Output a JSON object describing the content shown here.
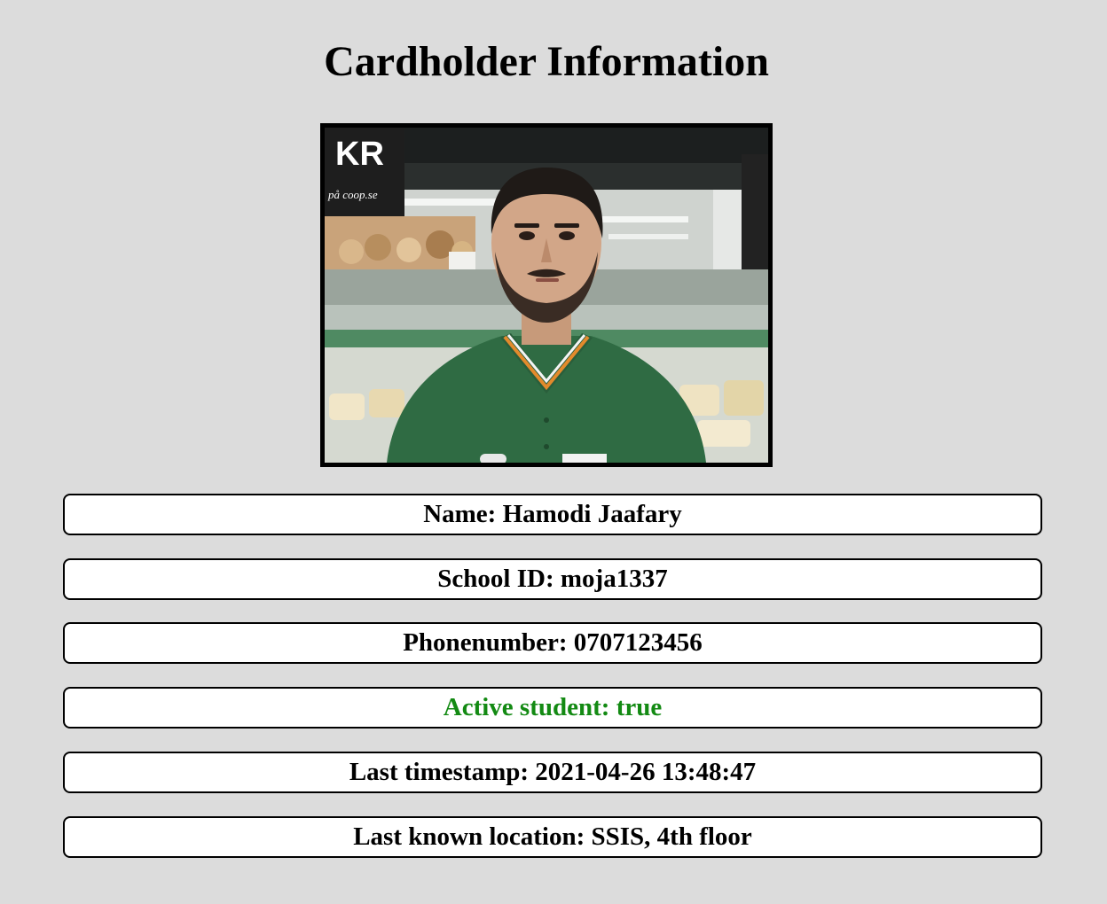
{
  "page": {
    "title": "Cardholder Information"
  },
  "photo": {
    "description_icon": "cardholder-photo"
  },
  "fields": [
    {
      "label": "Name: ",
      "value": "Hamodi Jaafary"
    },
    {
      "label": "School ID: ",
      "value": "moja1337"
    },
    {
      "label": "Phonenumber: ",
      "value": "0707123456"
    },
    {
      "label": "Active student: ",
      "value": "true"
    },
    {
      "label": "Last timestamp: ",
      "value": "2021-04-26 13:48:47"
    },
    {
      "label": "Last known location: ",
      "value": "SSIS, 4th floor"
    }
  ],
  "colors": {
    "background": "#dcdcdc",
    "active_status": "#138a13"
  },
  "photo_text": {
    "sign_letters": "KR",
    "sign_url": "på coop.se"
  }
}
